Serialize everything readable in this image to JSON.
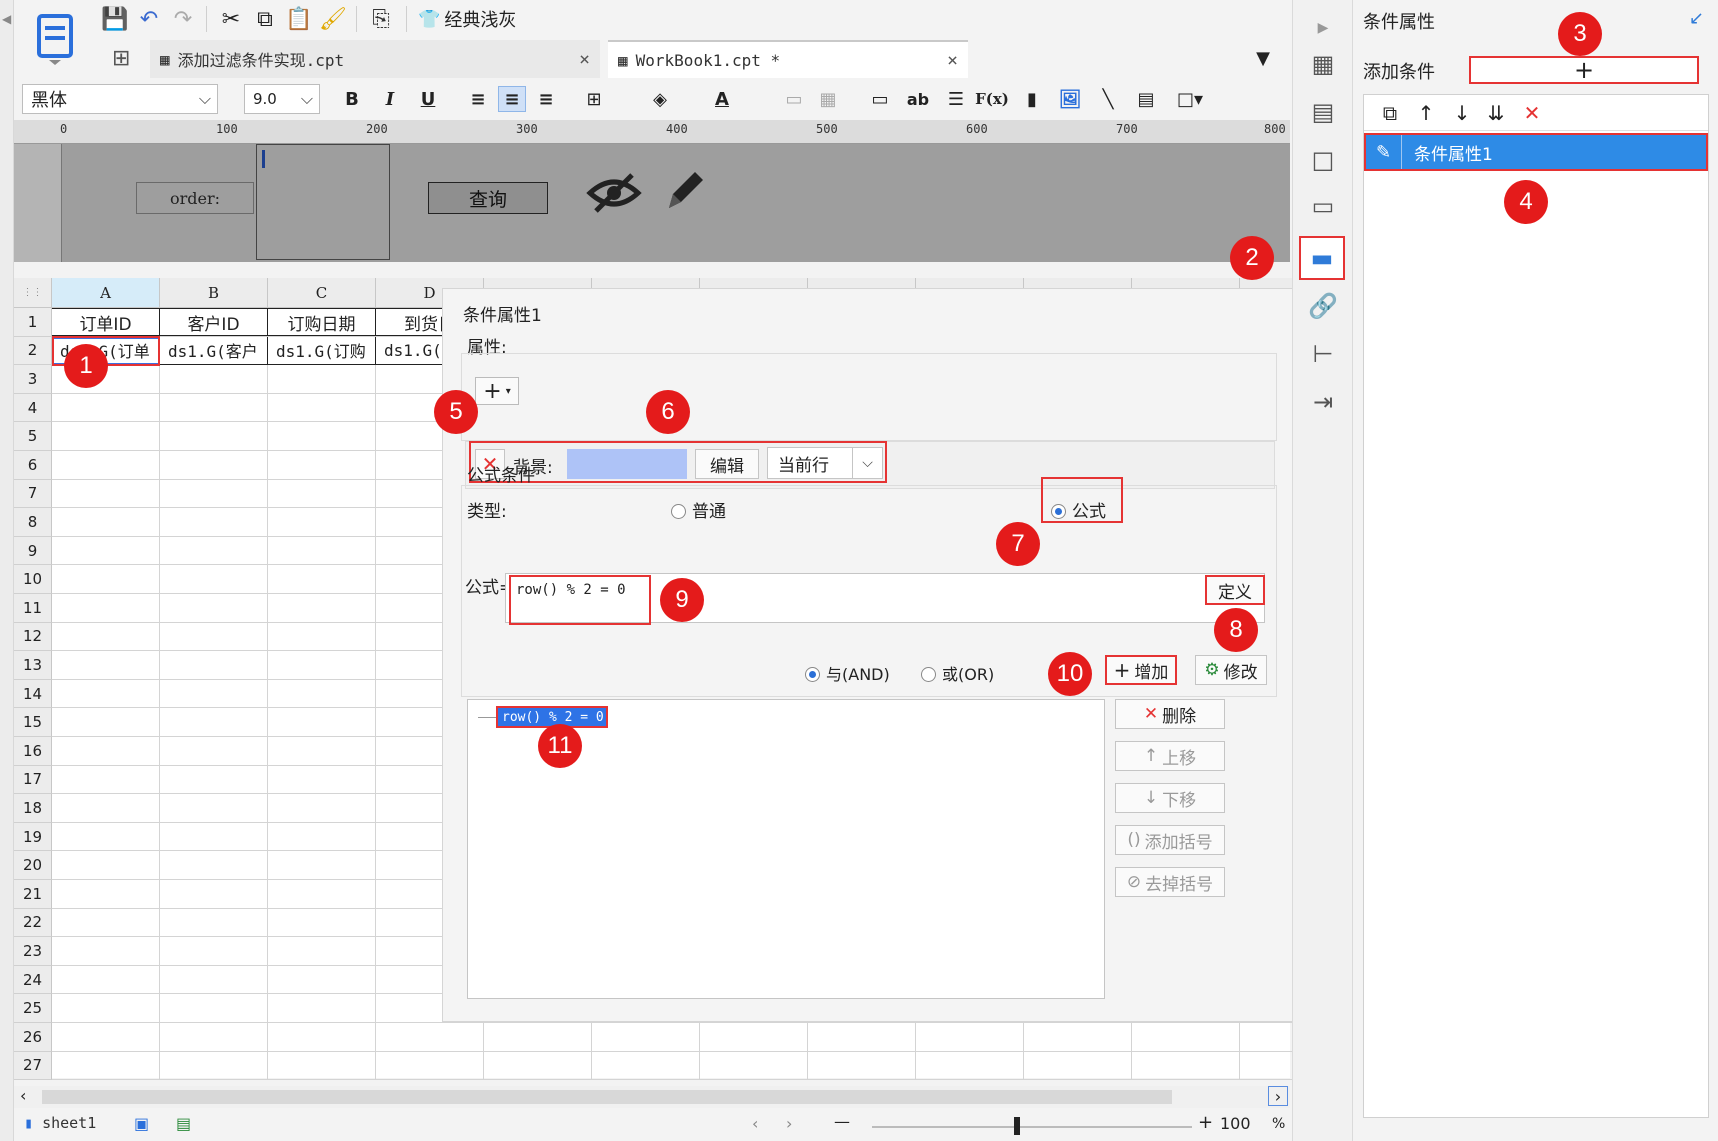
{
  "toolbar": {
    "classic_theme": "经典浅灰"
  },
  "tabs": [
    {
      "label": "添加过滤条件实现.cpt",
      "close": "×"
    },
    {
      "label": "WorkBook1.cpt *",
      "close": "×"
    }
  ],
  "format": {
    "font_name": "黑体",
    "font_size": "9.0",
    "bold": "B",
    "italic": "I",
    "underline": "U",
    "text_label": "ab",
    "formula_label": "F(x)"
  },
  "ruler": [
    "0",
    "100",
    "200",
    "300",
    "400",
    "500",
    "600",
    "700",
    "800"
  ],
  "param_panel": {
    "order_label": "order:",
    "query_button": "查询"
  },
  "sheet": {
    "columns": [
      "A",
      "B",
      "C",
      "D"
    ],
    "rows": [
      "1",
      "2",
      "3",
      "4",
      "5",
      "6",
      "7",
      "8",
      "9",
      "10",
      "11",
      "12",
      "13",
      "14",
      "15",
      "16",
      "17",
      "18",
      "19",
      "20",
      "21",
      "22",
      "23",
      "24",
      "25",
      "26",
      "27"
    ],
    "header_row": [
      "订单ID",
      "客户ID",
      "订购日期",
      "到货日"
    ],
    "data_row": [
      "ds1.G(订单",
      "ds1.G(客户",
      "ds1.G(订购",
      "ds1.G("
    ]
  },
  "statusbar": {
    "sheet_tab": "sheet1",
    "zoom_minus": "—",
    "zoom_plus": "+",
    "zoom": "100",
    "zoom_unit": "%"
  },
  "dialog": {
    "title": "条件属性1",
    "props_section": "属性:",
    "add_plus": "+",
    "delete_x": "✕",
    "background_label": "背景:",
    "edit_button": "编辑",
    "scope_value": "当前行",
    "formula_section": "公式条件",
    "type_label": "类型:",
    "radio_normal": "普通",
    "radio_formula": "公式",
    "formula_label": "公式=",
    "formula_value": "row() % 2 = 0",
    "define_button": "定义",
    "and_label": "与(AND)",
    "or_label": "或(OR)",
    "add_button": "增加",
    "modify_button": "修改",
    "delete_button": "删除",
    "up_button": "上移",
    "down_button": "下移",
    "add_paren_button": "添加括号",
    "remove_paren_button": "去掉括号",
    "condition_item": "row() % 2 = 0"
  },
  "props_panel": {
    "title": "条件属性",
    "add_condition_label": "添加条件",
    "add_condition_button": "+",
    "list_item": "条件属性1"
  },
  "badges": [
    "1",
    "2",
    "3",
    "4",
    "5",
    "6",
    "7",
    "8",
    "9",
    "10",
    "11"
  ],
  "colors": {
    "accent": "#2e8be6",
    "highlight_red": "#e53333",
    "badge_red": "#e41b1b",
    "background_swatch": "#aec3f7"
  }
}
